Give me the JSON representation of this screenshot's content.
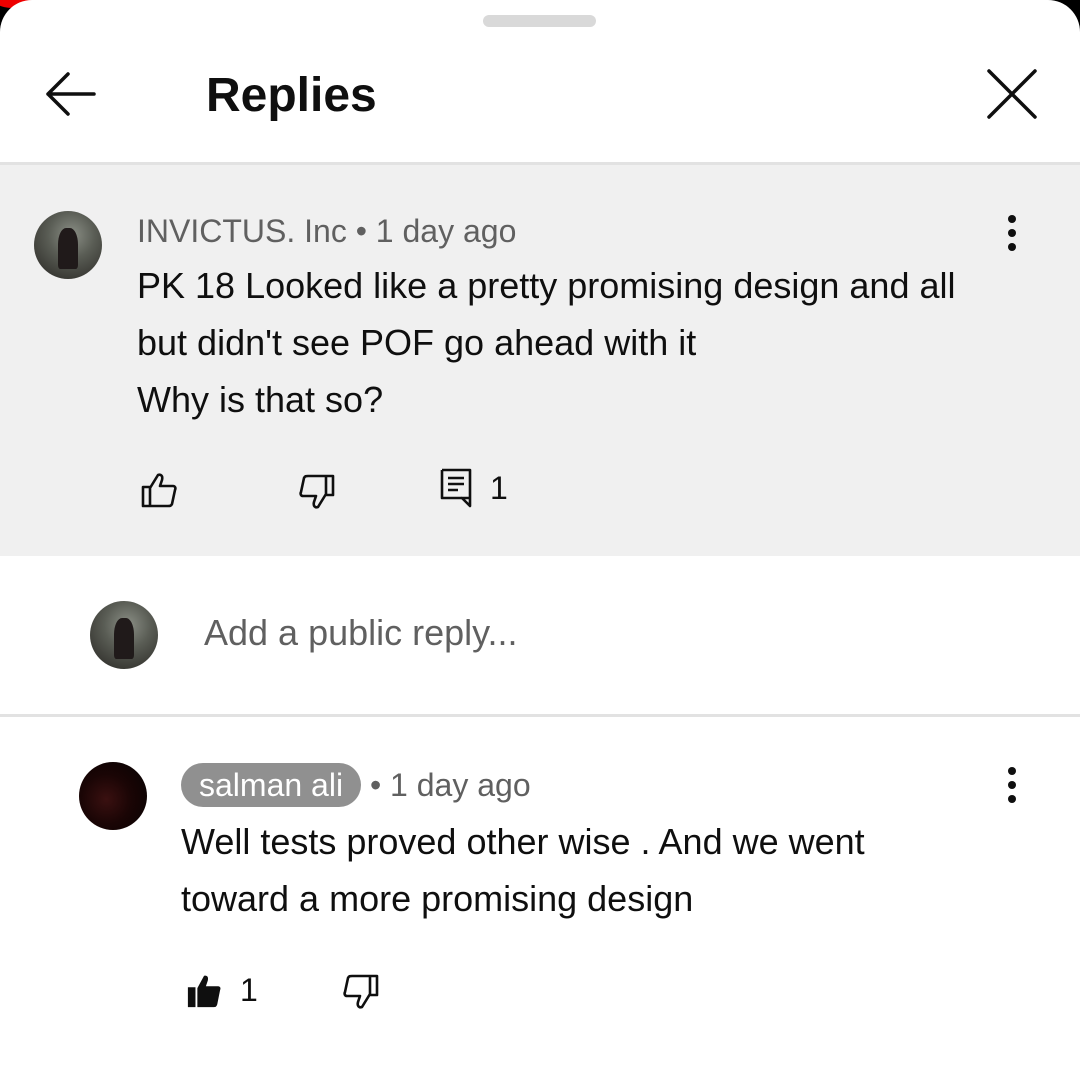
{
  "header": {
    "title": "Replies"
  },
  "parent_comment": {
    "author": "INVICTUS. Inc",
    "separator": " • ",
    "time": "1 day ago",
    "lines": [
      "PK 18 Looked like a pretty promising design and all",
      "but didn't see POF go ahead with it",
      "Why is that so?"
    ],
    "reply_count": "1"
  },
  "reply_box": {
    "placeholder": "Add a public reply..."
  },
  "replies": [
    {
      "author": "salman ali",
      "separator": " • ",
      "time": "1 day ago",
      "lines": [
        "Well tests proved other wise . And we went",
        "toward a more promising design"
      ],
      "like_count": "1"
    }
  ]
}
